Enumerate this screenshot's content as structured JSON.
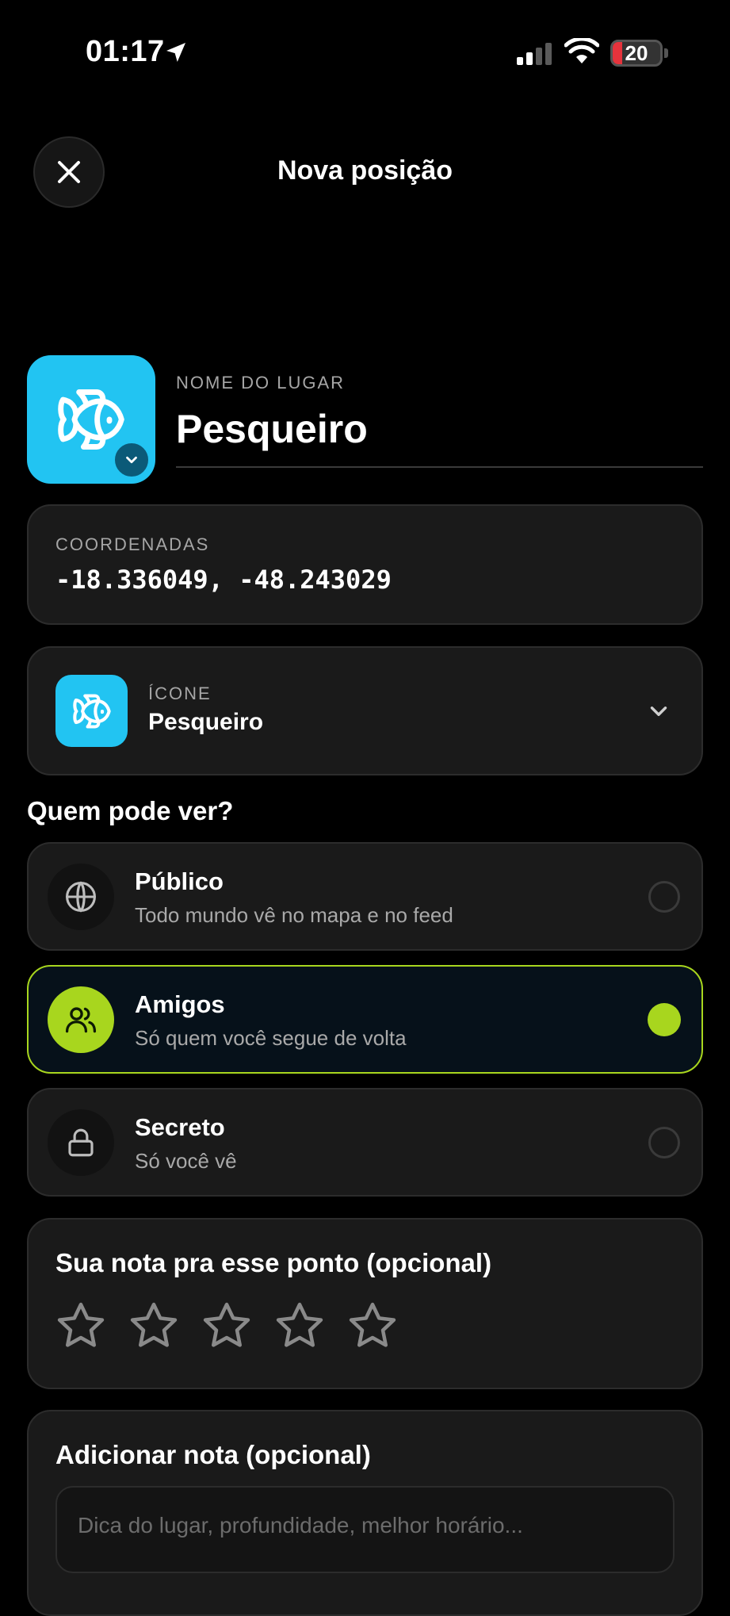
{
  "status_bar": {
    "time": "01:17",
    "battery": "20"
  },
  "header": {
    "title": "Nova posição"
  },
  "place": {
    "label": "NOME DO LUGAR",
    "name": "Pesqueiro"
  },
  "coordinates": {
    "label": "COORDENADAS",
    "value": "-18.336049, -48.243029"
  },
  "icon_selector": {
    "label": "ÍCONE",
    "value": "Pesqueiro",
    "icon": "fish-icon"
  },
  "visibility": {
    "title": "Quem pode ver?",
    "options": [
      {
        "title": "Público",
        "subtitle": "Todo mundo vê no mapa e no feed",
        "icon": "globe-icon",
        "selected": false
      },
      {
        "title": "Amigos",
        "subtitle": "Só quem você segue de volta",
        "icon": "users-icon",
        "selected": true
      },
      {
        "title": "Secreto",
        "subtitle": "Só você vê",
        "icon": "lock-icon",
        "selected": false
      }
    ]
  },
  "rating": {
    "title": "Sua nota pra esse ponto (opcional)",
    "stars": 0,
    "max": 5
  },
  "note": {
    "title": "Adicionar nota (opcional)",
    "placeholder": "Dica do lugar, profundidade, melhor horário..."
  },
  "colors": {
    "accent": "#a8d61e",
    "icon_bg": "#22c4f2",
    "battery_low": "#e5333c",
    "card_bg": "#1a1a1a"
  }
}
